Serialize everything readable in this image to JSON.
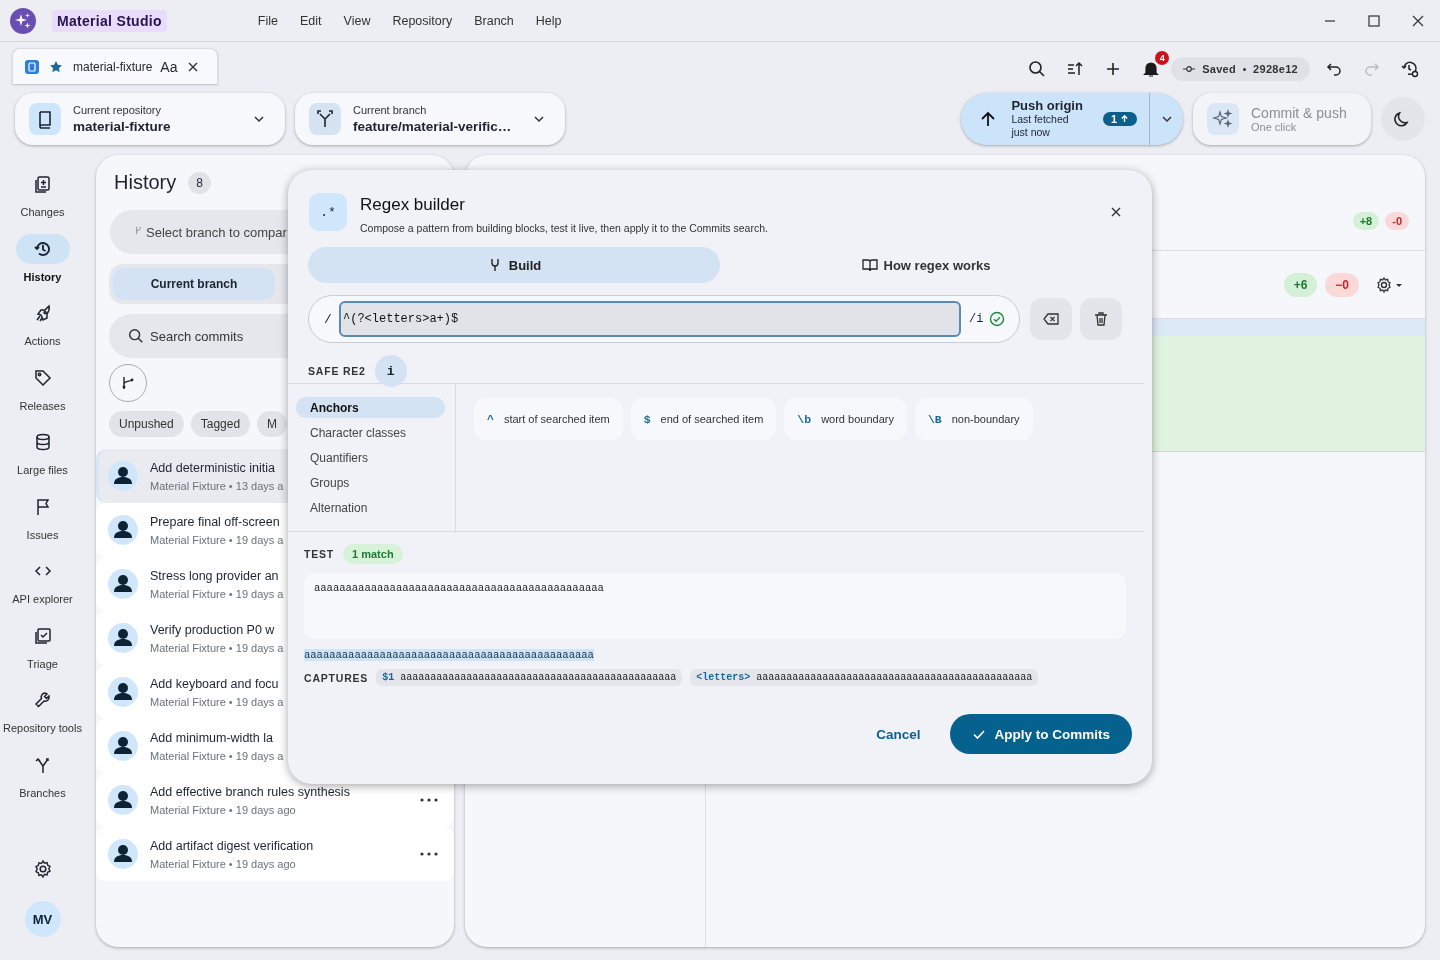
{
  "app": {
    "name": "Material Studio"
  },
  "menu": [
    "File",
    "Edit",
    "View",
    "Repository",
    "Branch",
    "Help"
  ],
  "tab": {
    "label": "material-fixture",
    "starred": true,
    "font_button": "Aa"
  },
  "toolbar": {
    "notifications": "4",
    "status": "Saved",
    "commit": "2928e12",
    "redo_disabled": true
  },
  "repository": {
    "label": "Current repository",
    "value": "material-fixture"
  },
  "branch": {
    "label": "Current branch",
    "value": "feature/material-verific…"
  },
  "push": {
    "title": "Push origin",
    "subtitle": "Last fetched just now",
    "count": "1"
  },
  "commit_push": {
    "title": "Commit & push",
    "subtitle": "One click",
    "disabled": true
  },
  "nav": [
    {
      "label": "Changes",
      "kind": "changes",
      "selected": false
    },
    {
      "label": "History",
      "kind": "history",
      "selected": true
    },
    {
      "label": "Actions",
      "kind": "actions",
      "selected": false
    },
    {
      "label": "Releases",
      "kind": "releases",
      "selected": false
    },
    {
      "label": "Large files",
      "kind": "storage",
      "selected": false
    },
    {
      "label": "Issues",
      "kind": "issues",
      "selected": false
    },
    {
      "label": "API explorer",
      "kind": "api",
      "selected": false
    },
    {
      "label": "Triage",
      "kind": "triage",
      "selected": false
    },
    {
      "label": "Repository tools",
      "kind": "tools",
      "selected": false
    },
    {
      "label": "Branches",
      "kind": "branches",
      "selected": false
    }
  ],
  "avatar": "MV",
  "history": {
    "title": "History",
    "count": "8",
    "compare_placeholder": "Select branch to compar",
    "segments": [
      {
        "label": "Current branch",
        "selected": true
      }
    ],
    "search_placeholder": "Search commits",
    "filters": [
      "Unpushed",
      "Tagged",
      "M"
    ],
    "commits": [
      {
        "title": "Add deterministic initia",
        "meta": "Material Fixture • 13 days a",
        "selected": true
      },
      {
        "title": "Prepare final off-screen",
        "meta": "Material Fixture • 19 days a",
        "selected": false
      },
      {
        "title": "Stress long provider an",
        "meta": "Material Fixture • 19 days a",
        "selected": false
      },
      {
        "title": "Verify production P0 w",
        "meta": "Material Fixture • 19 days a",
        "selected": false
      },
      {
        "title": "Add keyboard and focu",
        "meta": "Material Fixture • 19 days a",
        "selected": false
      },
      {
        "title": "Add minimum-width la",
        "meta": "Material Fixture • 19 days a",
        "selected": false
      },
      {
        "title": "Add effective branch rules synthesis",
        "meta": "Material Fixture • 19 days ago",
        "selected": false
      },
      {
        "title": "Add artifact digest verification",
        "meta": "Material Fixture • 19 days ago",
        "selected": false
      }
    ]
  },
  "diff": {
    "summary": {
      "added": "+8",
      "removed": "-0"
    },
    "file": {
      "added": "+6",
      "removed": "−0"
    }
  },
  "regex_builder": {
    "title": "Regex builder",
    "subtitle": "Compose a pattern from building blocks, test it live, then apply it to the Commits search.",
    "icon_text": ".*",
    "tabs": [
      {
        "label": "Build",
        "kind": "build",
        "selected": true
      },
      {
        "label": "How regex works",
        "kind": "guide",
        "selected": false
      }
    ],
    "pattern": {
      "prefix": "/",
      "value": "^(?<letters>a+)$",
      "flags": "/i",
      "valid": true
    },
    "engine": "SAFE RE2",
    "info": "i",
    "categories": [
      {
        "label": "Anchors",
        "selected": true
      },
      {
        "label": "Character classes",
        "selected": false
      },
      {
        "label": "Quantifiers",
        "selected": false
      },
      {
        "label": "Groups",
        "selected": false
      },
      {
        "label": "Alternation",
        "selected": false
      }
    ],
    "tokens": [
      {
        "token": "^",
        "label": "start of searched item"
      },
      {
        "token": "$",
        "label": "end of searched item"
      },
      {
        "token": "\\b",
        "label": "word boundary"
      },
      {
        "token": "\\B",
        "label": "non-boundary"
      }
    ],
    "test": {
      "label": "TEST",
      "matches": "1 match",
      "text": "aaaaaaaaaaaaaaaaaaaaaaaaaaaaaaaaaaaaaaaaaaaaaa",
      "match": "aaaaaaaaaaaaaaaaaaaaaaaaaaaaaaaaaaaaaaaaaaaaaa"
    },
    "captures": {
      "label": "CAPTURES",
      "items": [
        {
          "name": "$1",
          "value": "aaaaaaaaaaaaaaaaaaaaaaaaaaaaaaaaaaaaaaaaaaaaaa"
        },
        {
          "name": "<letters>",
          "value": "aaaaaaaaaaaaaaaaaaaaaaaaaaaaaaaaaaaaaaaaaaaaaa"
        }
      ]
    },
    "cancel": "Cancel",
    "apply": "Apply to Commits"
  }
}
